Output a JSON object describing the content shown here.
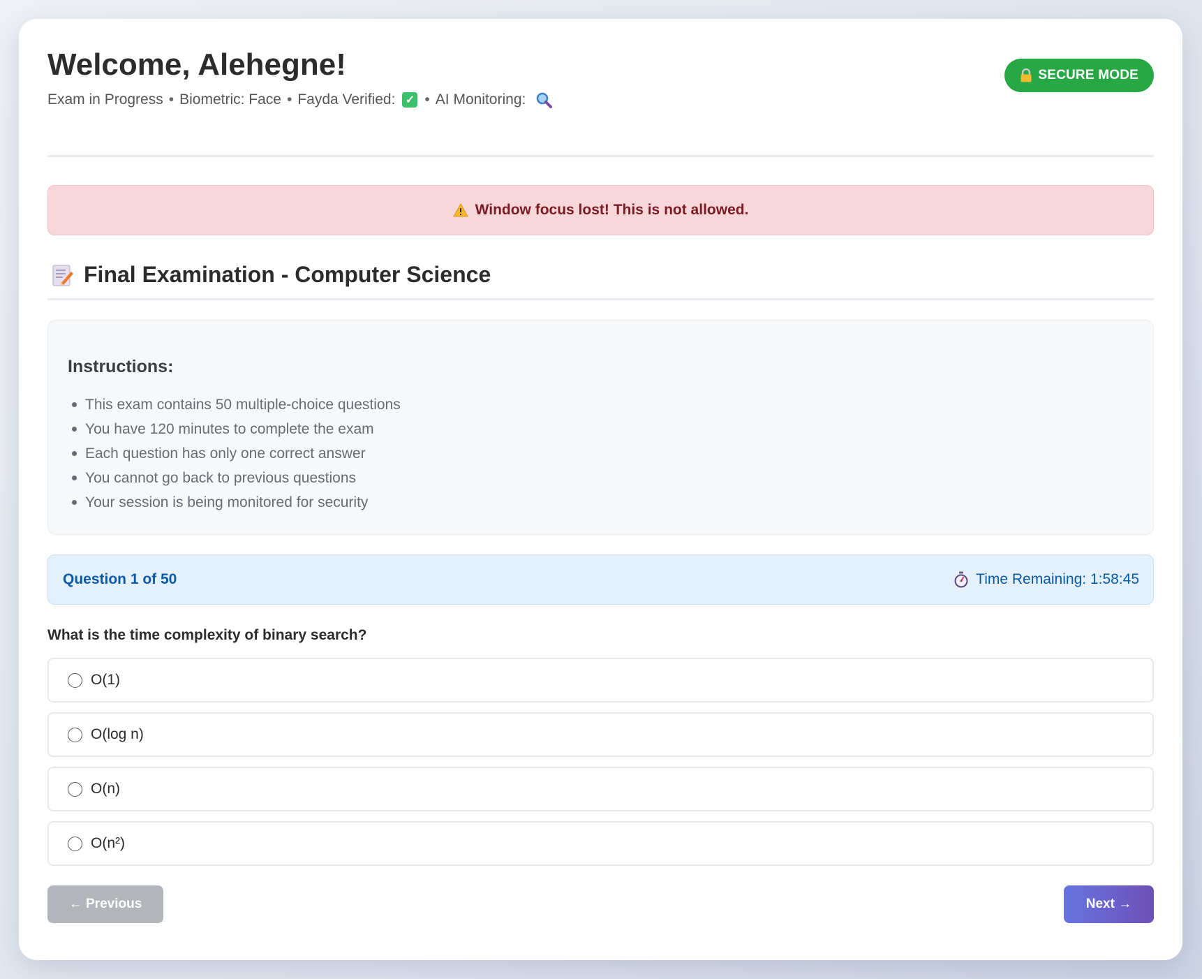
{
  "header": {
    "welcome": "Welcome, Alehegne!",
    "status": "Exam in Progress",
    "biometric": "Biometric: Face",
    "fayda": "Fayda Verified:",
    "ai_monitoring": "AI Monitoring:",
    "secure_badge": "SECURE MODE"
  },
  "alert": {
    "message": "Window focus lost! This is not allowed."
  },
  "exam": {
    "title": "Final Examination - Computer Science"
  },
  "instructions": {
    "heading": "Instructions:",
    "items": [
      "This exam contains 50 multiple-choice questions",
      "You have 120 minutes to complete the exam",
      "Each question has only one correct answer",
      "You cannot go back to previous questions",
      "Your session is being monitored for security"
    ]
  },
  "question": {
    "counter": "Question 1 of 50",
    "timer": "Time Remaining: 1:58:45",
    "text": "What is the time complexity of binary search?",
    "options": [
      "O(1)",
      "O(log n)",
      "O(n)",
      "O(n²)"
    ]
  },
  "nav": {
    "previous": "← Previous",
    "next": "Next →"
  },
  "colors": {
    "secure_green": "#28a745",
    "alert_bg": "#f8d7da",
    "alert_text": "#7a1c24",
    "question_bar_bg": "#e4f1fd",
    "question_bar_text": "#0b5aa8",
    "next_gradient_start": "#6675df",
    "next_gradient_end": "#6f4fb8",
    "prev_disabled": "#b2b6ba"
  },
  "icons": {
    "verified": "check-box-icon",
    "monitoring": "magnifier-icon",
    "secure": "lock-icon",
    "alert": "warning-icon",
    "title": "memo-icon",
    "timer": "stopwatch-icon"
  }
}
